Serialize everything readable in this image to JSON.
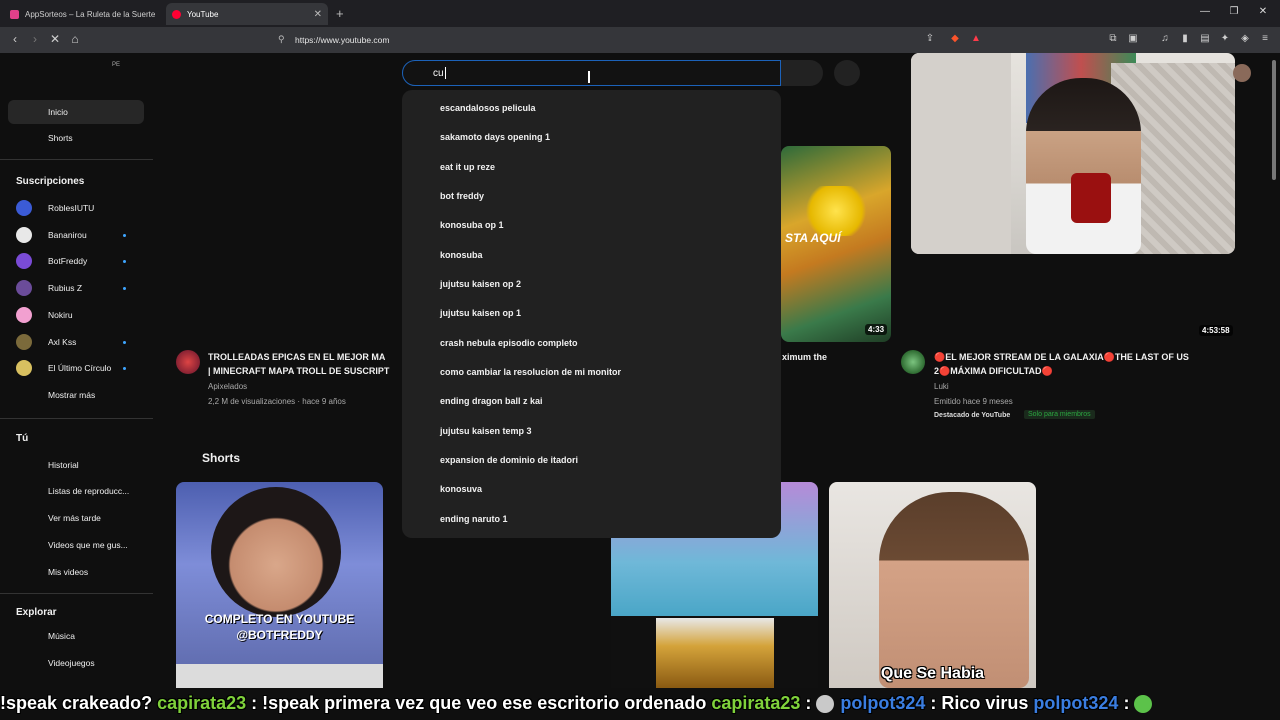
{
  "browser": {
    "tabs": [
      {
        "label": "AppSorteos – La Ruleta de la Suerte",
        "active": false
      },
      {
        "label": "YouTube",
        "active": true
      }
    ],
    "url": "https://www.youtube.com"
  },
  "youtube": {
    "country_code": "PE",
    "search": {
      "value": "cu"
    },
    "suggestions": [
      "escandalosos pelicula",
      "sakamoto days opening 1",
      "eat it up reze",
      "bot freddy",
      "konosuba op 1",
      "konosuba",
      "jujutsu kaisen op 2",
      "jujutsu kaisen op 1",
      "crash nebula episodio completo",
      "como cambiar la resolucion de mi monitor",
      "ending dragon ball z kai",
      "jujutsu kaisen temp 3",
      "expansion de dominio de itadori",
      "konosuva",
      "ending naruto 1"
    ]
  },
  "sidebar": {
    "home": "Inicio",
    "shorts": "Shorts",
    "subscriptions_heading": "Suscripciones",
    "subscriptions": [
      {
        "name": "RoblesIUTU",
        "color": "#3b5bd6",
        "dot": false
      },
      {
        "name": "Bananirou",
        "color": "#e8e8e8",
        "dot": true
      },
      {
        "name": "BotFreddy",
        "color": "#7a4bd6",
        "dot": true
      },
      {
        "name": "Rubius Z",
        "color": "#6b4c9a",
        "dot": true
      },
      {
        "name": "Nokiru",
        "color": "#f2a0d0",
        "dot": false
      },
      {
        "name": "Axl Kss",
        "color": "#7b6a3b",
        "dot": true
      },
      {
        "name": "El Último Círculo",
        "color": "#d8c060",
        "dot": true
      }
    ],
    "show_more": "Mostrar más",
    "you_heading": "Tú",
    "you_items": [
      "Historial",
      "Listas de reproducc...",
      "Ver más tarde",
      "Videos que me gus...",
      "Mis videos"
    ],
    "explore_heading": "Explorar",
    "explore_items": [
      "Música",
      "Videojuegos"
    ]
  },
  "videos": {
    "v1": {
      "title_line1": "TROLLEADAS EPICAS EN EL MEJOR MA",
      "title_line2": "| MINECRAFT MAPA TROLL DE SUSCRIPT",
      "channel": "Apixelados",
      "meta": "2,2 M de visualizaciones · hace 9 años"
    },
    "v2": {
      "title_line1": "ximum the",
      "duration": "4:33",
      "thumb_text": "STA AQUÍ"
    },
    "v3": {
      "title_line1": "🔴EL MEJOR STREAM DE LA GALAXIA🔴THE LAST OF US",
      "title_line2": "2🔴MÁXIMA DIFICULTAD🔴",
      "channel": "Luki",
      "meta": "Emitido hace 9 meses",
      "badge": "Destacado de YouTube",
      "members": "Solo para miembros",
      "duration": "4:53:58"
    }
  },
  "shorts": {
    "heading": "Shorts",
    "s1_caption_line1": "COMPLETO EN YOUTUBE",
    "s1_caption_line2": "@BOTFREDDY",
    "s4_caption": "Que Se Habia"
  },
  "ticker": [
    {
      "text": "!speak crakeado? ",
      "color": "#ffffff"
    },
    {
      "text": "capirata23",
      "color": "#7fd13b"
    },
    {
      "text": " : !speak primera vez que veo ese escritorio ordenado ",
      "color": "#ffffff"
    },
    {
      "text": "capirata23",
      "color": "#7fd13b"
    },
    {
      "text": " :  ",
      "color": "#ffffff"
    },
    {
      "text": "polpot324",
      "color": "#3a7de0"
    },
    {
      "text": " : Rico virus  ",
      "color": "#ffffff"
    },
    {
      "text": "polpot324",
      "color": "#3a7de0"
    },
    {
      "text": " : ",
      "color": "#ffffff"
    }
  ],
  "colors": {
    "accent_blue": "#1c62b9",
    "member_green": "#2ba640"
  }
}
